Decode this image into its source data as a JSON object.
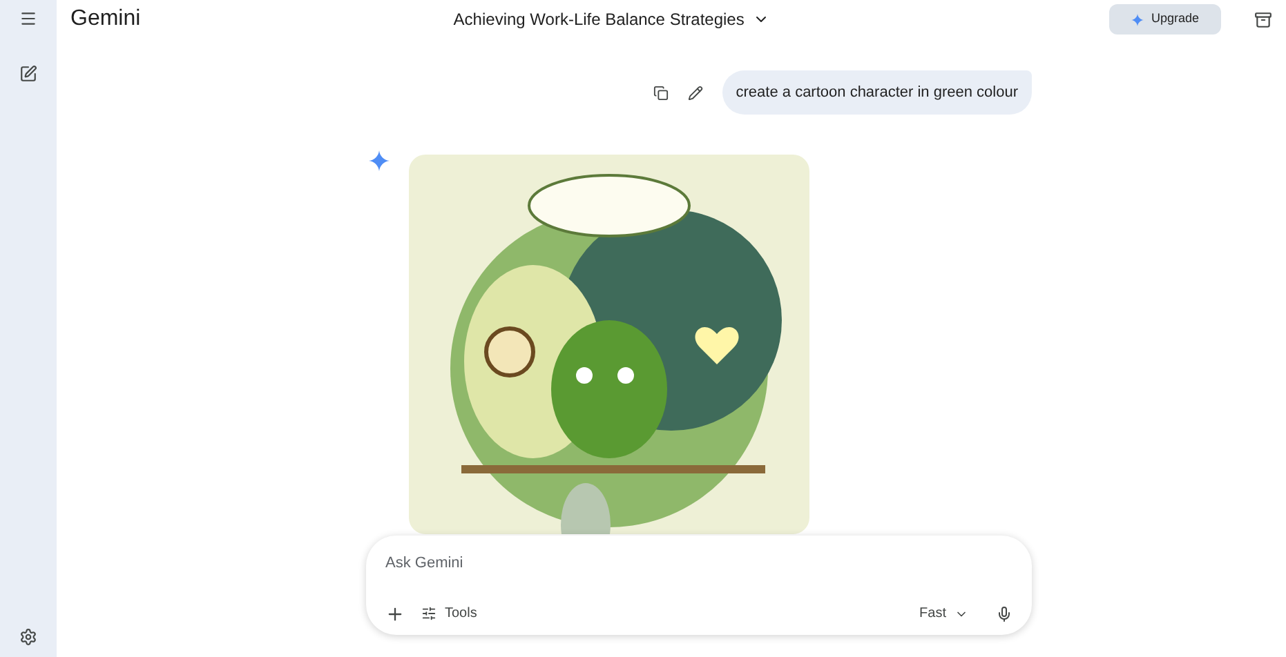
{
  "app": {
    "title": "Gemini"
  },
  "conversation": {
    "title": "Achieving Work-Life Balance Strategies"
  },
  "upgrade_button": {
    "label": "Upgrade"
  },
  "user_message": {
    "text": "create a cartoon character in green colour"
  },
  "composer": {
    "placeholder": "Ask Gemini",
    "tools_label": "Tools",
    "mode": "Fast"
  }
}
